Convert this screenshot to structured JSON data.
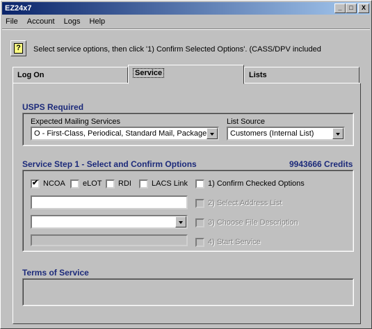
{
  "window": {
    "title": "EZ24x7",
    "controls": {
      "minimize": "_",
      "maximize": "□",
      "close": "X"
    }
  },
  "menu": {
    "items": [
      "File",
      "Account",
      "Logs",
      "Help"
    ]
  },
  "toolbar": {
    "help_label": "?",
    "instruction": "Select service options, then click '1) Confirm Selected Options'. (CASS/DPV included"
  },
  "tabs": [
    "Log On",
    "Service",
    "Lists"
  ],
  "usps": {
    "title": "USPS Required",
    "mail_services_label": "Expected Mailing Services",
    "mail_services_value": "O - First-Class, Periodical, Standard Mail, Packages",
    "list_source_label": "List Source",
    "list_source_value": "Customers (Internal List)"
  },
  "step1": {
    "title": "Service Step 1 - Select and Confirm Options",
    "credits": "9943666 Credits",
    "options": [
      {
        "label": "NCOA",
        "checked": true
      },
      {
        "label": "eLOT",
        "checked": false
      },
      {
        "label": "RDI",
        "checked": false
      },
      {
        "label": "LACS Link",
        "checked": false
      }
    ],
    "confirm_label": "1) Confirm Checked Options",
    "select_address_label": "2) Select Address List",
    "file_description_label": "3) Choose File Description",
    "start_service_label": "4) Start Service"
  },
  "terms": {
    "title": "Terms of Service"
  },
  "icons": {
    "help": "help-question-icon",
    "dropdown": "chevron-down-icon",
    "check": "checkmark-icon"
  },
  "colors": {
    "accent": "#1c2a7a",
    "title_bar": "#0a246a",
    "window_bg": "#c0c0c0"
  }
}
